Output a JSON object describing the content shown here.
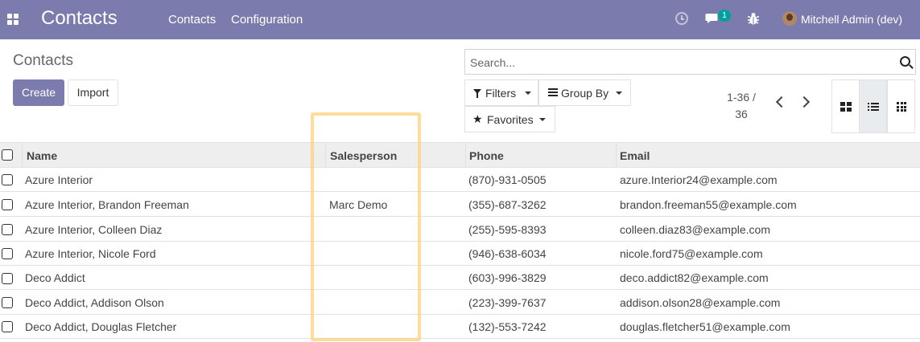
{
  "navbar": {
    "app_name": "Contacts",
    "menu": [
      "Contacts",
      "Configuration"
    ],
    "messages_count": "1",
    "user_name": "Mitchell Admin (dev)",
    "bg_color": "#7c7bad"
  },
  "control_panel": {
    "breadcrumb": "Contacts",
    "create_label": "Create",
    "import_label": "Import",
    "search_placeholder": "Search...",
    "filters_label": "Filters",
    "group_by_label": "Group By",
    "favorites_label": "Favorites",
    "pager_value": "1-36 /",
    "pager_total": "36",
    "icons": [
      "filter-icon",
      "bars-icon",
      "star-icon",
      "chevron-left-icon",
      "chevron-right-icon",
      "kanban-view-icon",
      "list-view-icon",
      "grid-view-icon"
    ]
  },
  "table": {
    "headers": [
      "Name",
      "Salesperson",
      "Phone",
      "Email"
    ],
    "rows": [
      {
        "name": "Azure Interior",
        "salesperson": "",
        "phone": "(870)-931-0505",
        "email": "azure.Interior24@example.com"
      },
      {
        "name": "Azure Interior, Brandon Freeman",
        "salesperson": "Marc Demo",
        "phone": "(355)-687-3262",
        "email": "brandon.freeman55@example.com"
      },
      {
        "name": "Azure Interior, Colleen Diaz",
        "salesperson": "",
        "phone": "(255)-595-8393",
        "email": "colleen.diaz83@example.com"
      },
      {
        "name": "Azure Interior, Nicole Ford",
        "salesperson": "",
        "phone": "(946)-638-6034",
        "email": "nicole.ford75@example.com"
      },
      {
        "name": "Deco Addict",
        "salesperson": "",
        "phone": "(603)-996-3829",
        "email": "deco.addict82@example.com"
      },
      {
        "name": "Deco Addict, Addison Olson",
        "salesperson": "",
        "phone": "(223)-399-7637",
        "email": "addison.olson28@example.com"
      },
      {
        "name": "Deco Addict, Douglas Fletcher",
        "salesperson": "",
        "phone": "(132)-553-7242",
        "email": "douglas.fletcher51@example.com"
      }
    ]
  },
  "highlight_color": "#fdd078"
}
